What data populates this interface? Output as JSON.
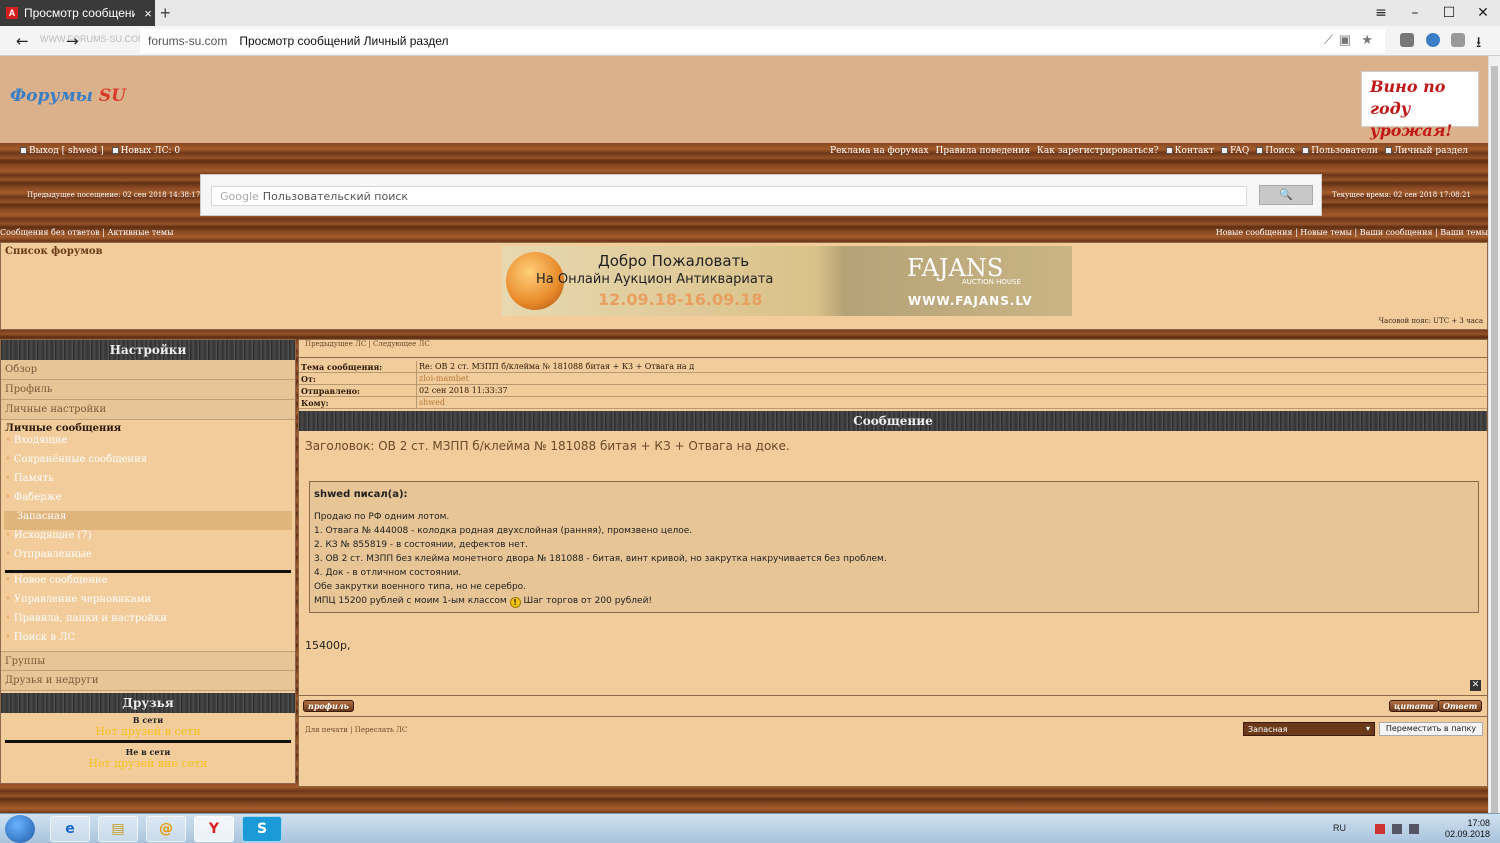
{
  "browser": {
    "tab_title": "Просмотр сообщений Л",
    "tab_icon": "A",
    "url_domain": "forums-su.com",
    "url_title": "Просмотр сообщений Личный раздел",
    "watermark": "WWW.FORUMS-SU.COM"
  },
  "header": {
    "logo_part1": "Форумы",
    "logo_part2": "SU",
    "ad_line1": "Вино по",
    "ad_line2": "году урожая!"
  },
  "topnav": {
    "left": [
      "Выход [ shwed ]",
      "Новых ЛС: 0"
    ],
    "right": [
      "Реклама на форумах",
      "Правила поведения",
      "Как зарегистрироваться?",
      "Контакт",
      "FAQ",
      "Поиск",
      "Пользователи",
      "Личный раздел"
    ]
  },
  "info": {
    "prev_visit": "Предыдущее посещение: 02 сен 2018 14:38:17",
    "current_time": "Текущее время: 02 сен 2018 17:08:21"
  },
  "search": {
    "google": "Google",
    "placeholder": "Пользовательский поиск",
    "button": "🔍"
  },
  "links": {
    "left": "Сообщения без ответов | Активные темы",
    "right": "Новые сообщения | Новые темы | Ваши сообщения | Ваши темы"
  },
  "forumbar": {
    "list": "Список форумов",
    "timezone": "Часовой пояс: UTC + 3 часа"
  },
  "banner": {
    "line1": "Добро Пожаловать",
    "line2": "На Онлайн Аукцион Антиквариата",
    "dates": "12.09.18-16.09.18",
    "brand": "FAJANS",
    "brand_sub": "AUCTION HOUSE",
    "site": "WWW.FAJANS.LV"
  },
  "sidebar": {
    "title": "Настройки",
    "items": [
      "Обзор",
      "Профиль",
      "Личные настройки"
    ],
    "pm_title": "Личные сообщения",
    "folders": [
      "Входящие",
      "Сохранённые сообщения",
      "Память",
      "Фаберже",
      "Запасная",
      "Исходящие (7)",
      "Отправленные"
    ],
    "actions": [
      "Новое сообщение",
      "Управление черновиками",
      "Правила, папки и настройки",
      "Поиск в ЛС"
    ],
    "groups": "Группы",
    "friends_foes": "Друзья и недруги",
    "friends_title": "Друзья",
    "online": "В сети",
    "none_online": "Нет друзей в сети",
    "offline": "Не в сети",
    "none_offline": "Нет друзей вне сети"
  },
  "pm": {
    "nav": "Предыдущее ЛС | Следующее ЛС",
    "rows": [
      {
        "k": "Тема сообщения:",
        "v": "Re: ОВ 2 ст. МЗПП б/клейма № 181088 битая + КЗ + Отвага на д"
      },
      {
        "k": "От:",
        "v": "zloi-mambet"
      },
      {
        "k": "Отправлено:",
        "v": "02 сен 2018 11:33:37"
      },
      {
        "k": "Кому:",
        "v": "shwed"
      }
    ],
    "section": "Сообщение",
    "subject": "Заголовок: ОВ 2 ст. МЗПП б/клейма № 181088 битая + КЗ + Отвага на доке.",
    "quote_author": "shwed писал(а):",
    "quote_lines": [
      "Продаю по РФ одним лотом.",
      "1. Отвага № 444008 - колодка родная двухслойная (ранняя), промзвено целое.",
      "2. КЗ № 855819 - в состоянии, дефектов нет.",
      "3. ОВ 2 ст. МЗПП без клейма монетного двора № 181088 - битая, винт кривой, но закрутка накручивается без проблем.",
      "4. Док - в отличном состоянии.",
      "Обе закрутки военного типа, но не серебро."
    ],
    "quote_last_a": "МПЦ 15200 рублей с моим 1-ым классом",
    "quote_last_b": "Шаг торгов от 200 рублей!",
    "reply": "15400р,",
    "profile_btn": "профиль",
    "quote_btn": "цитата",
    "answer_btn": "Ответ",
    "footer": "Для печати | Переслать ЛС",
    "folder_select": "Запасная",
    "move_btn": "Переместить в папку"
  },
  "taskbar": {
    "lang": "RU",
    "time": "17:08",
    "date": "02.09.2018"
  }
}
